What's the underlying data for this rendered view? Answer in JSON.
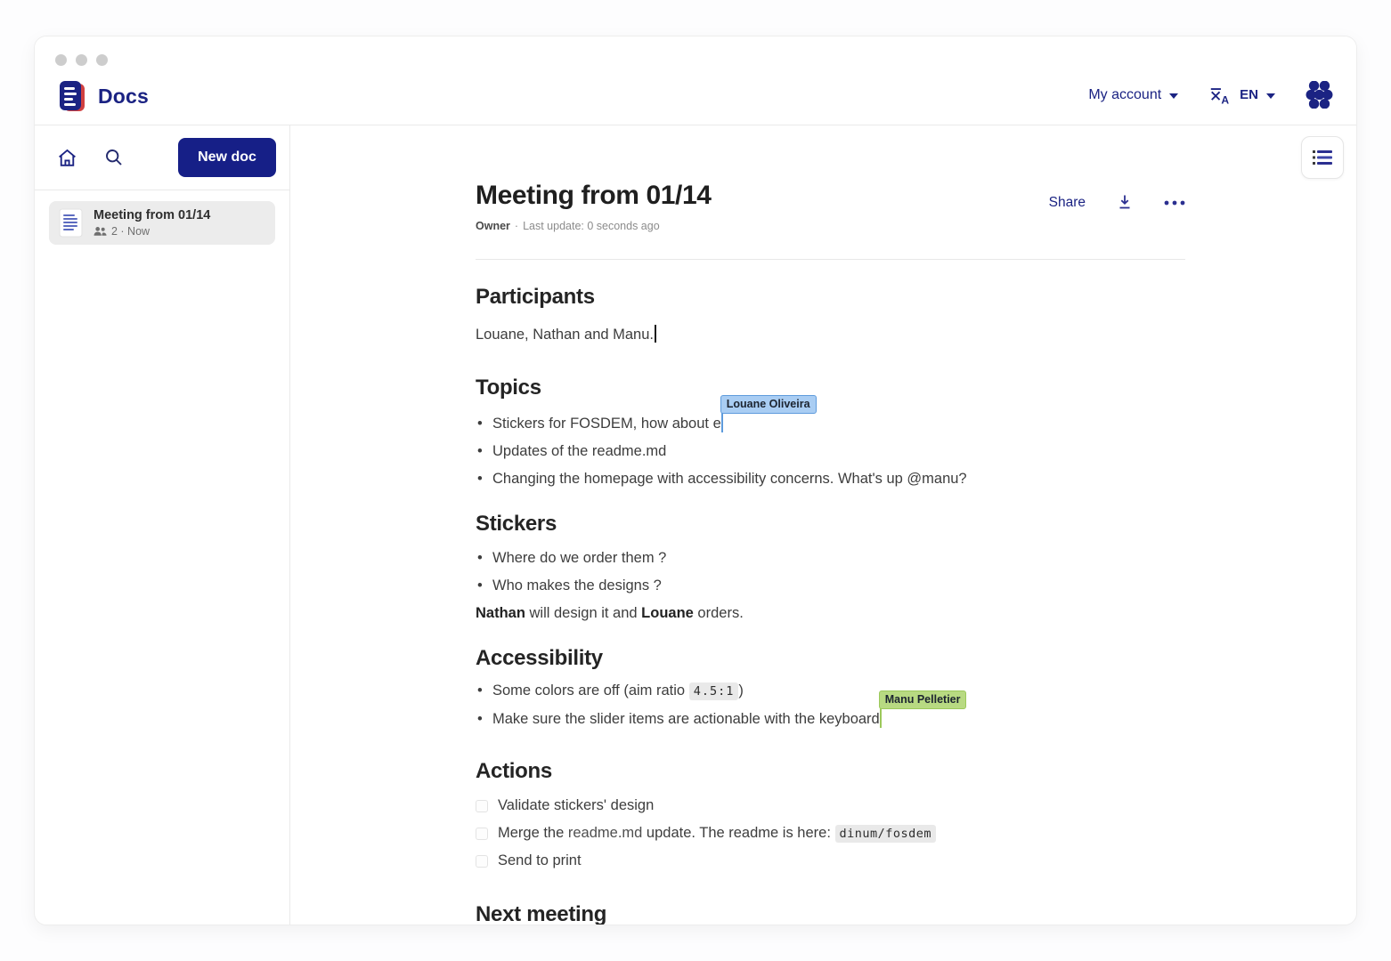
{
  "header": {
    "app_name": "Docs",
    "account_label": "My account",
    "language": "EN"
  },
  "sidebar": {
    "new_doc_label": "New doc",
    "doc_item": {
      "title": "Meeting from 01/14",
      "meta": "2 · Now"
    }
  },
  "doc": {
    "title": "Meeting from 01/14",
    "role": "Owner",
    "separator": "·",
    "last_update": "Last update: 0 seconds ago",
    "share_label": "Share"
  },
  "content": {
    "participants": {
      "heading": "Participants",
      "text": "Louane, Nathan and Manu."
    },
    "topics": {
      "heading": "Topics",
      "items": [
        "Stickers for FOSDEM, how about e",
        "Updates of the readme.md",
        "Changing the homepage with accessibility concerns. What's up @manu?"
      ]
    },
    "stickers": {
      "heading": "Stickers",
      "items": [
        "Where do we order them ?",
        "Who makes the designs ?"
      ],
      "note": {
        "b1": "Nathan",
        "t1": " will design it and ",
        "b2": "Louane",
        "t2": " orders."
      }
    },
    "accessibility": {
      "heading": "Accessibility",
      "item1_pre": "Some colors are off (aim ratio ",
      "item1_code": "4.5:1",
      "item1_post": ")",
      "item2": "Make sure the slider items are actionable with the keyboard"
    },
    "actions": {
      "heading": "Actions",
      "todos": [
        {
          "pre": "Validate stickers' design"
        },
        {
          "pre": "Merge the ",
          "link": "readme.md",
          "mid": " update. The readme is here: ",
          "code": "dinum/fosdem"
        },
        {
          "pre": "Send to print"
        }
      ]
    },
    "next": {
      "heading": "Next meeting"
    }
  },
  "collaborators": [
    {
      "name": "Louane Oliveira",
      "color": "#A9CDF3",
      "caret_color": "#5E9BDC"
    },
    {
      "name": "Manu Pelletier",
      "color": "#B8DA82",
      "caret_color": "#9CC95B"
    }
  ],
  "colors": {
    "primary": "#1B2383",
    "button": "#161F87",
    "logo_red": "#D04040"
  }
}
